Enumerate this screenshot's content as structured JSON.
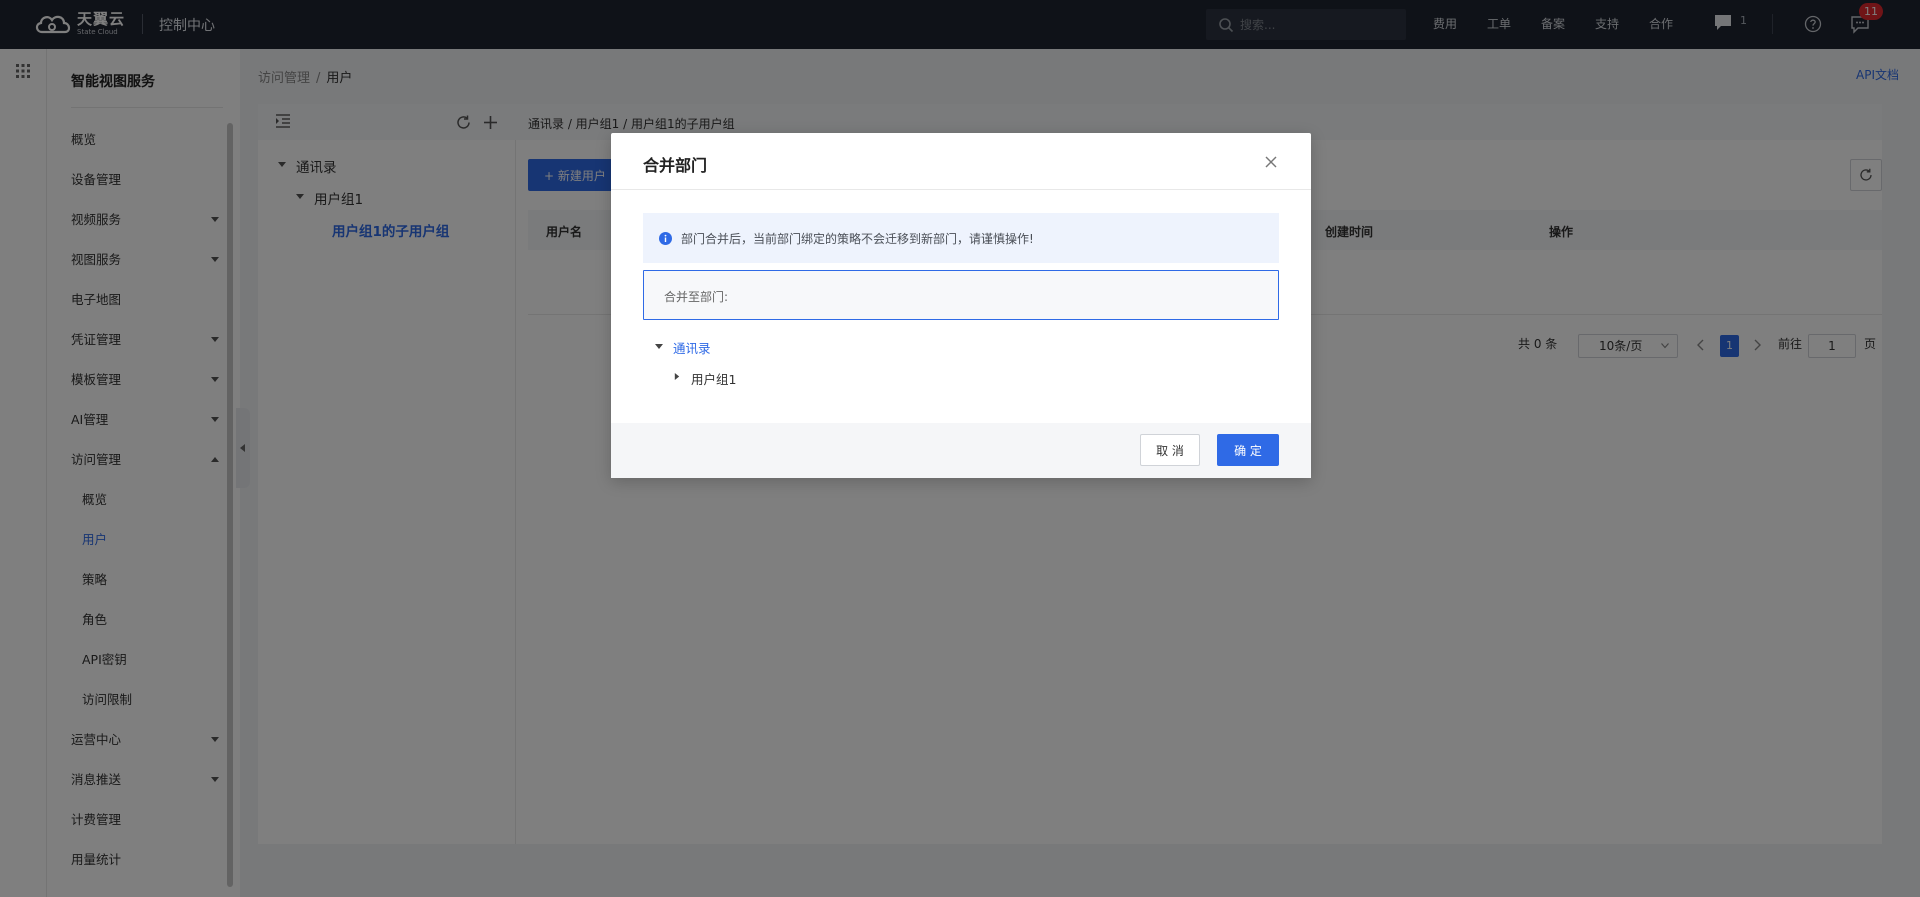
{
  "topbar": {
    "logo_main": "天翼云",
    "logo_sub": "State Cloud",
    "console_title": "控制中心",
    "search_placeholder": "搜索...",
    "nav": [
      "费用",
      "工单",
      "备案",
      "支持",
      "合作"
    ],
    "chat_count": "1",
    "message_badge": "11"
  },
  "sidebar": {
    "title": "智能视图服务",
    "items": [
      {
        "label": "概览"
      },
      {
        "label": "设备管理"
      },
      {
        "label": "视频服务"
      },
      {
        "label": "视图服务"
      },
      {
        "label": "电子地图"
      },
      {
        "label": "凭证管理"
      },
      {
        "label": "模板管理"
      },
      {
        "label": "AI管理"
      },
      {
        "label": "访问管理"
      },
      {
        "label": "概览"
      },
      {
        "label": "用户"
      },
      {
        "label": "策略"
      },
      {
        "label": "角色"
      },
      {
        "label": "API密钥"
      },
      {
        "label": "访问限制"
      },
      {
        "label": "运营中心"
      },
      {
        "label": "消息推送"
      },
      {
        "label": "计费管理"
      },
      {
        "label": "用量统计"
      }
    ]
  },
  "breadcrumb": {
    "parent": "访问管理",
    "separator": "/",
    "current": "用户"
  },
  "api_doc": "API文档",
  "tree": {
    "root": "通讯录",
    "group": "用户组1",
    "subgroup": "用户组1的子用户组"
  },
  "main": {
    "path": "通讯录 / 用户组1 / 用户组1的子用户组",
    "new_user_button": "+ 新建用户",
    "columns": [
      "用户名",
      "创建时间",
      "操作"
    ],
    "pager": {
      "total": "共 0 条",
      "page_size": "10条/页",
      "current_page": "1",
      "goto_label": "前往",
      "goto_value": "1",
      "page_unit": "页"
    }
  },
  "modal": {
    "title": "合并部门",
    "alert": "部门合并后，当前部门绑定的策略不会迁移到新部门，请谨慎操作!",
    "field_label": "合并至部门:",
    "tree_root": "通讯录",
    "tree_child": "用户组1",
    "cancel": "取 消",
    "confirm": "确 定"
  },
  "colors": {
    "primary": "#2f6ae6",
    "topbar_bg": "#1f2430",
    "badge": "#e0282e"
  }
}
